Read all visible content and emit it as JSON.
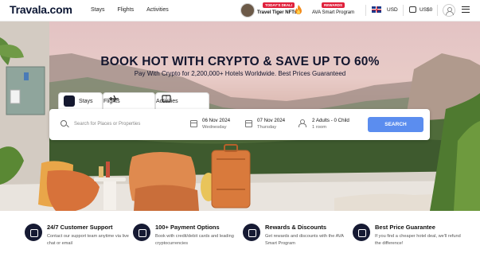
{
  "header": {
    "logo": "Travala.com",
    "nav": [
      "Stays",
      "Flights",
      "Activities"
    ],
    "promo_badge": "TODAY'S DEAL!",
    "promo_label": "Travel Tiger NFTs",
    "ava_badge": "REWARDS",
    "ava_label": "AVA Smart Program",
    "currency": "USD",
    "wallet_amount": "US$0"
  },
  "hero": {
    "headline": "BOOK HOT WITH CRYPTO & SAVE UP TO 60%",
    "subline": "Pay With Crypto for 2,200,000+ Hotels Worldwide. Best Prices Guaranteed"
  },
  "tabs": [
    {
      "label": "Stays",
      "icon": "bed-icon",
      "active": true
    },
    {
      "label": "Flights",
      "icon": "plane-icon",
      "active": false
    },
    {
      "label": "Activities",
      "icon": "ticket-icon",
      "active": false
    }
  ],
  "search": {
    "placeholder": "Search for Places or Properties",
    "checkin_date": "06 Nov 2024",
    "checkin_day": "Wednesday",
    "checkout_date": "07 Nov 2024",
    "checkout_day": "Thursday",
    "guests": "2 Adults - 0 Child",
    "rooms": "1 room",
    "button": "SEARCH"
  },
  "features": [
    {
      "title": "24/7 Customer Support",
      "desc": "Contact our support team anytime via live chat or email",
      "icon": "headset-icon"
    },
    {
      "title": "100+ Payment Options",
      "desc": "Book with credit/debit cards and leading cryptocurrencies",
      "icon": "wallet-icon"
    },
    {
      "title": "Rewards & Discounts",
      "desc": "Get rewards and discounts with the AVA Smart Program",
      "icon": "gift-icon"
    },
    {
      "title": "Best Price Guarantee",
      "desc": "If you find a cheaper hotel deal, we'll refund the difference!",
      "icon": "price-tag-icon"
    }
  ],
  "colors": {
    "brand_dark": "#13162e",
    "search_button": "#5b8def",
    "badge_red": "#e0203b"
  }
}
